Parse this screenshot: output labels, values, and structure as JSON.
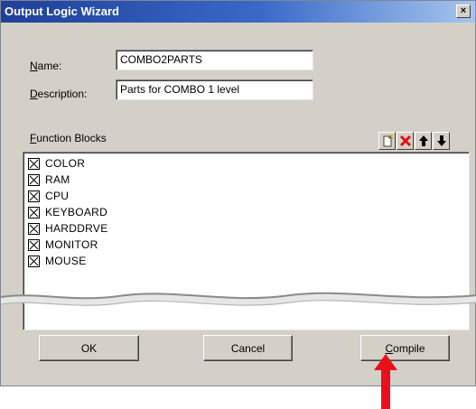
{
  "window": {
    "title": "Output Logic Wizard",
    "close_glyph": "×"
  },
  "form": {
    "name_label": "Name:",
    "name_value": "COMBO2PARTS",
    "description_label": "Description:",
    "description_value": "Parts for COMBO 1 level"
  },
  "function_blocks": {
    "label": "Function Blocks",
    "toolbar_icons": [
      "new-block-icon",
      "delete-x-icon",
      "arrow-up-icon",
      "arrow-down-icon"
    ],
    "items": [
      {
        "label": "COLOR",
        "checked": true
      },
      {
        "label": "RAM",
        "checked": true
      },
      {
        "label": "CPU",
        "checked": true
      },
      {
        "label": "KEYBOARD",
        "checked": true
      },
      {
        "label": "HARDDRVE",
        "checked": true
      },
      {
        "label": "MONITOR",
        "checked": true
      },
      {
        "label": "MOUSE",
        "checked": true
      }
    ]
  },
  "buttons": {
    "ok": "OK",
    "cancel": "Cancel",
    "compile": "Compile"
  },
  "colors": {
    "title_gradient_start": "#1f3f9a",
    "title_gradient_end": "#a6c6ee",
    "dialog_bg": "#d4d0c8",
    "annotation_arrow": "#e8101a"
  }
}
